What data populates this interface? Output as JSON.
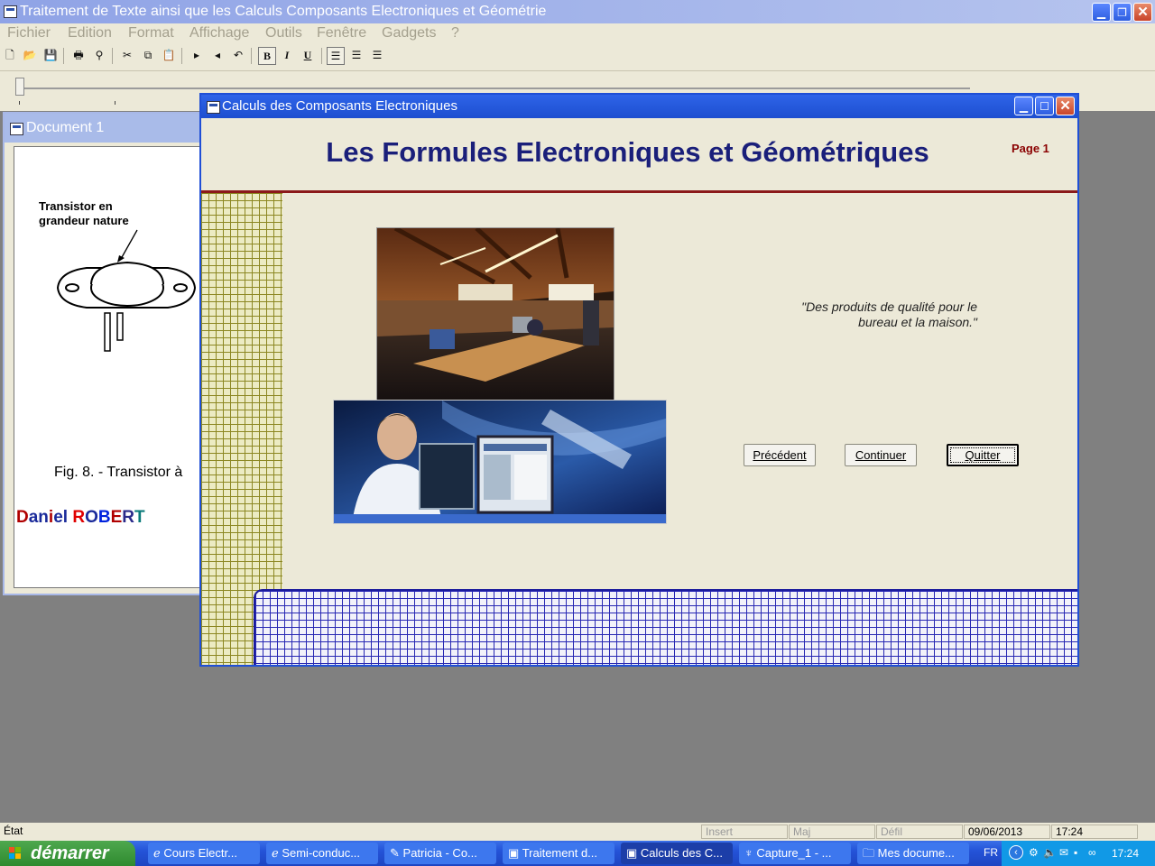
{
  "app": {
    "title": "Traitement de Texte ainsi que les Calculs Composants Electroniques et Géométrie",
    "menu": [
      "Fichier",
      "Edition",
      "Format",
      "Affichage",
      "Outils",
      "Fenêtre",
      "Gadgets",
      "?"
    ],
    "toolbar": {
      "bold": "B",
      "italic": "I",
      "underline": "U"
    }
  },
  "document": {
    "title": "Document 1",
    "caption_transistor": [
      "Transistor en",
      "grandeur nature"
    ],
    "figure_caption": "Fig. 8. - Transistor à",
    "author": [
      {
        "t": "D",
        "c": "#b00000"
      },
      {
        "t": "an",
        "c": "#1a2a9a"
      },
      {
        "t": "i",
        "c": "#b00000"
      },
      {
        "t": "e",
        "c": "#1a2a9a"
      },
      {
        "t": "l ",
        "c": "#1a2a9a"
      },
      {
        "t": "R",
        "c": "#e00000"
      },
      {
        "t": "O",
        "c": "#1a2a9a"
      },
      {
        "t": "B",
        "c": "#0022dd"
      },
      {
        "t": "E",
        "c": "#b00000"
      },
      {
        "t": "R",
        "c": "#2a2a8a"
      },
      {
        "t": "T",
        "c": "#0a7a7a"
      }
    ]
  },
  "dialog": {
    "title": "Calculs des Composants Electroniques",
    "headline": "Les Formules Electroniques et Géométriques",
    "page": "Page 1",
    "quote_line1": "\"Des produits de qualité pour le",
    "quote_line2": "bureau et la maison.\"",
    "buttons": {
      "previous": "Précédent",
      "continue": "Continuer",
      "quit": "Quitter"
    }
  },
  "status": {
    "state": "État",
    "insert": "Insert",
    "caps": "Maj",
    "scroll": "Défil",
    "date": "09/06/2013",
    "time": "17:24"
  },
  "taskbar": {
    "start": "démarrer",
    "tasks": [
      {
        "label": "Cours Electr..."
      },
      {
        "label": "Semi-conduc..."
      },
      {
        "label": "Patricia - Co..."
      },
      {
        "label": "Traitement d..."
      },
      {
        "label": "Calculs des C..."
      },
      {
        "label": "Capture_1 - ..."
      },
      {
        "label": "Mes docume..."
      }
    ],
    "lang": "FR",
    "clock": "17:24"
  },
  "colors": {
    "dialog_border": "#1f4fd6",
    "headline": "#1a1f7a",
    "accent_rule": "#8b1a1a",
    "page_num": "#8a0000"
  }
}
